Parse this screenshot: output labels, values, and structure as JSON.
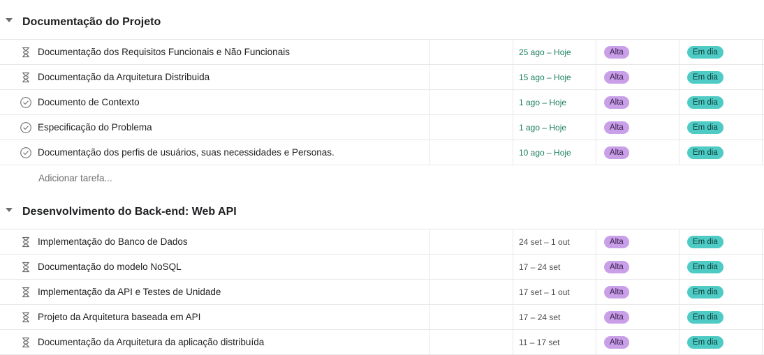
{
  "colors": {
    "priority_high": "#c9a0e8",
    "status_on_track": "#4ecbc4",
    "date_due_today": "#1a7f5a"
  },
  "sections": [
    {
      "title": "Documentação do Projeto",
      "add_task_label": "Adicionar tarefa...",
      "tasks": [
        {
          "icon": "hourglass-icon",
          "name": "Documentação dos Requisitos Funcionais e Não Funcionais",
          "date": "25 ago – Hoje",
          "priority": "Alta",
          "status": "Em dia"
        },
        {
          "icon": "hourglass-icon",
          "name": "Documentação da Arquitetura Distribuida",
          "date": "15 ago – Hoje",
          "priority": "Alta",
          "status": "Em dia"
        },
        {
          "icon": "check-circle-icon",
          "name": "Documento de Contexto",
          "date": "1 ago – Hoje",
          "priority": "Alta",
          "status": "Em dia"
        },
        {
          "icon": "check-circle-icon",
          "name": "Especificação do Problema",
          "date": "1 ago – Hoje",
          "priority": "Alta",
          "status": "Em dia"
        },
        {
          "icon": "check-circle-icon",
          "name": "Documentação dos perfis de usuários, suas necessidades e Personas.",
          "date": "10 ago – Hoje",
          "priority": "Alta",
          "status": "Em dia"
        }
      ]
    },
    {
      "title": "Desenvolvimento do Back-end: Web API",
      "tasks": [
        {
          "icon": "hourglass-icon",
          "name": "Implementação do Banco de Dados",
          "date": "24 set – 1 out",
          "priority": "Alta",
          "status": "Em dia"
        },
        {
          "icon": "hourglass-icon",
          "name": "Documentação do modelo NoSQL",
          "date": "17 – 24 set",
          "priority": "Alta",
          "status": "Em dia"
        },
        {
          "icon": "hourglass-icon",
          "name": "Implementação da API e Testes de Unidade",
          "date": "17 set – 1 out",
          "priority": "Alta",
          "status": "Em dia"
        },
        {
          "icon": "hourglass-icon",
          "name": "Projeto da Arquitetura baseada em API",
          "date": "17 – 24 set",
          "priority": "Alta",
          "status": "Em dia"
        },
        {
          "icon": "hourglass-icon",
          "name": "Documentação da Arquitetura da aplicação distribuída",
          "date": "11 – 17 set",
          "priority": "Alta",
          "status": "Em dia"
        }
      ]
    }
  ]
}
